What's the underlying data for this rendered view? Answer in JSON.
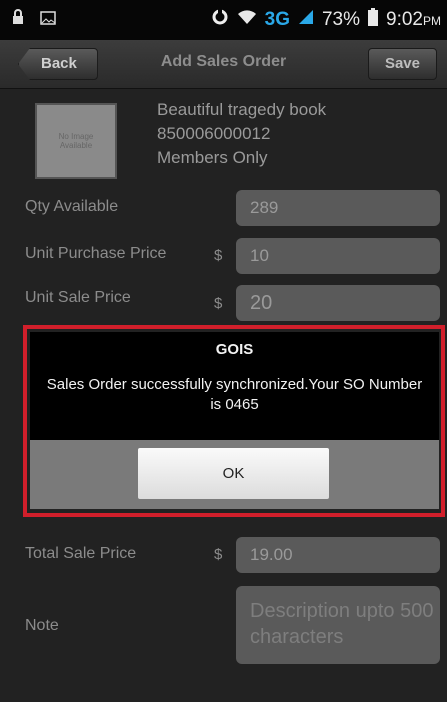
{
  "status_bar": {
    "lock_icon": "lock-icon",
    "image_icon": "image-icon",
    "sync_icon": "sync-icon",
    "wifi_icon": "wifi-icon",
    "network": "3G",
    "signal_icon": "signal-icon",
    "battery_percent": "73%",
    "battery_icon": "battery-icon",
    "time": "9:02",
    "ampm": "PM"
  },
  "nav": {
    "back_label": "Back",
    "title": "Add Sales Order",
    "save_label": "Save"
  },
  "product": {
    "image_placeholder_line1": "No Image",
    "image_placeholder_line2": "Available",
    "name": "Beautiful tragedy book",
    "code": "850006000012",
    "availability": "Members Only"
  },
  "form": {
    "qty_available": {
      "label": "Qty Available",
      "value": "289"
    },
    "unit_purchase_price": {
      "label": "Unit Purchase Price",
      "currency": "$",
      "value": "10"
    },
    "unit_sale_price": {
      "label": "Unit Sale Price",
      "currency": "$",
      "value": "20"
    },
    "total_sale_price": {
      "label": "Total Sale Price",
      "currency": "$",
      "value": "19.00"
    },
    "note": {
      "label": "Note",
      "placeholder": "Description upto 500 characters"
    }
  },
  "dialog": {
    "title": "GOIS",
    "message": "Sales Order successfully synchronized.Your SO Number is 0465",
    "ok_label": "OK",
    "highlight_color": "#d11f2b"
  }
}
